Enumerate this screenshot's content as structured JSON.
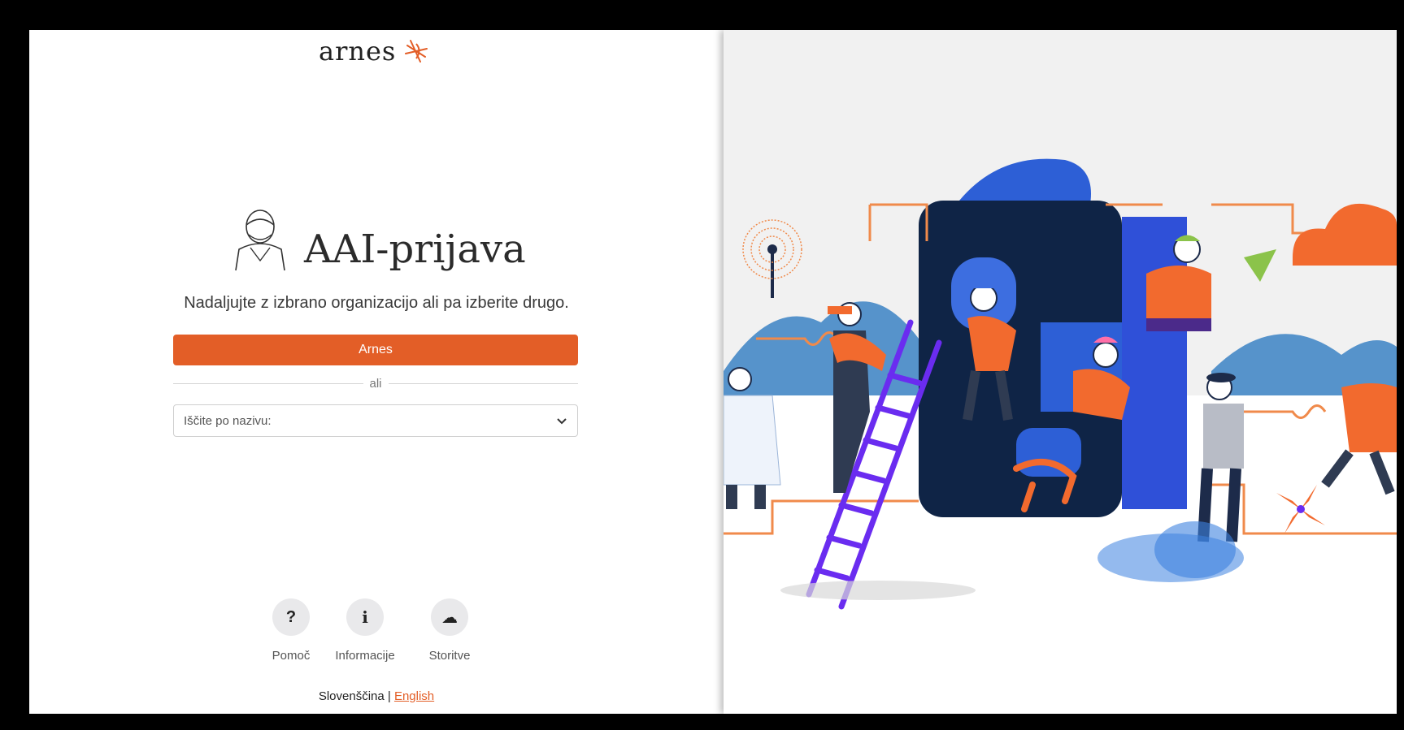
{
  "brand": {
    "logo_text": "arnes",
    "accent": "#e35e27"
  },
  "login": {
    "title": "AAI-prijava",
    "subtitle": "Nadaljujte z izbrano organizacijo ali pa izberite drugo.",
    "org_button_label": "Arnes",
    "divider_text": "ali",
    "search_placeholder": "Iščite po nazivu:"
  },
  "footer_links": [
    {
      "icon": "question-icon",
      "glyph": "?",
      "label": "Pomoč"
    },
    {
      "icon": "info-icon",
      "glyph": "i",
      "label": "Informacije"
    },
    {
      "icon": "cloud-icon",
      "glyph": "☁",
      "label": "Storitve"
    }
  ],
  "language": {
    "current": "Slovenščina",
    "separator": " | ",
    "other": "English"
  }
}
